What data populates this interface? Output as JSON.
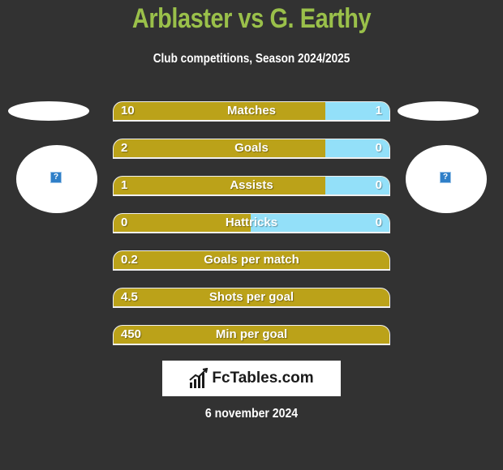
{
  "header": {
    "title": "Arblaster vs G. Earthy",
    "subtitle": "Club competitions, Season 2024/2025"
  },
  "players": {
    "left": {
      "logo_icon": "image-placeholder-icon",
      "logo_glyph": "?"
    },
    "right": {
      "logo_icon": "image-placeholder-icon",
      "logo_glyph": "?"
    }
  },
  "colors": {
    "background": "#323232",
    "title": "#9ac04a",
    "left_bar": "#bba219",
    "right_bar": "#93e0f9"
  },
  "stats": [
    {
      "label": "Matches",
      "left": "10",
      "right": "1",
      "left_share": 0.77
    },
    {
      "label": "Goals",
      "left": "2",
      "right": "0",
      "left_share": 0.77
    },
    {
      "label": "Assists",
      "left": "1",
      "right": "0",
      "left_share": 0.77
    },
    {
      "label": "Hattricks",
      "left": "0",
      "right": "0",
      "left_share": 0.5
    },
    {
      "label": "Goals per match",
      "left": "0.2",
      "right": null,
      "left_share": 1.0
    },
    {
      "label": "Shots per goal",
      "left": "4.5",
      "right": null,
      "left_share": 1.0
    },
    {
      "label": "Min per goal",
      "left": "450",
      "right": null,
      "left_share": 1.0
    }
  ],
  "brand": {
    "text": "FcTables.com",
    "icon": "bar-chart-icon"
  },
  "footer": {
    "date": "6 november 2024"
  }
}
